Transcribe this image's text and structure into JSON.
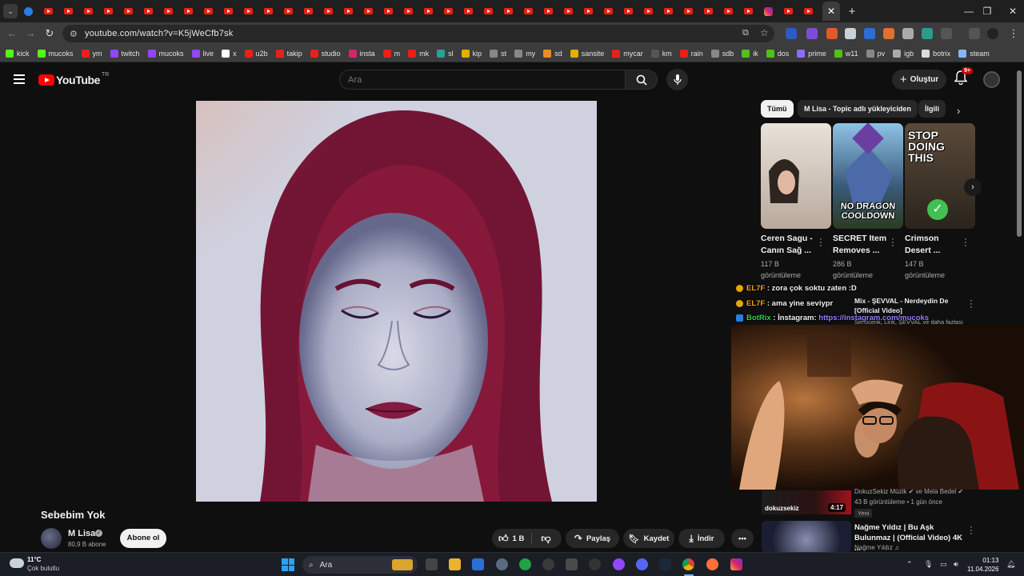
{
  "browser": {
    "url": "youtube.com/watch?v=K5jWeCfb7sk",
    "bookmarks": [
      "kick",
      "mucoks",
      "ym",
      "twitch",
      "mucoks",
      "live",
      "x",
      "u2b",
      "takip",
      "studio",
      "insta",
      "m",
      "mk",
      "sl",
      "kip",
      "st",
      "my",
      "sd",
      "sansite",
      "mycar",
      "km",
      "rain",
      "sdb",
      "ik",
      "dos",
      "prime",
      "w11",
      "pv",
      "igb",
      "botrix",
      "steam"
    ],
    "bookmark_colors": [
      "#53fc18",
      "#53fc18",
      "#e62117",
      "#9146ff",
      "#9146ff",
      "#9146ff",
      "#ffffff",
      "#e62117",
      "#e62117",
      "#e62117",
      "#d6246e",
      "#e62117",
      "#e62117",
      "#2aa198",
      "#e0b000",
      "#888888",
      "#888888",
      "#f08a24",
      "#e0b000",
      "#e62117",
      "#555555",
      "#e62117",
      "#888888",
      "#53c018",
      "#53c018",
      "#8f6bff",
      "#53c018",
      "#888888",
      "#aaaaaa",
      "#dddddd",
      "#8ab4f8"
    ]
  },
  "youtube": {
    "logo_text": "YouTube",
    "region": "TR",
    "search_placeholder": "Ara",
    "create_label": "Oluştur",
    "notif_count": "9+"
  },
  "video": {
    "title": "Sebebim Yok",
    "channel": "M Lisa",
    "subscribers": "80,9 B abone",
    "subscribe_label": "Abone ol",
    "likes": "1 B",
    "share_label": "Paylaş",
    "save_label": "Kaydet",
    "download_label": "İndir"
  },
  "sidebar": {
    "chips": [
      "Tümü",
      "M Lisa - Topic adlı yükleyiciden",
      "İlgili"
    ],
    "shorts": [
      {
        "title": "Ceren Sagu - Canın Sağ ...",
        "views": "117 B görüntüleme"
      },
      {
        "title": "SECRET Item Removes ...",
        "views": "286 B görüntüleme",
        "overlay": "NO DRAGON COOLDOWN"
      },
      {
        "title": "Crimson Desert ...",
        "views": "147 B görüntüleme",
        "overlay": "STOP DOING THIS"
      }
    ],
    "mix_title": "Mix - ŞEVVAL - Nerdeydin De [Official Video]",
    "mix_sub": "Semicenk, Lirik, ŞEVVAL ve daha fazlası",
    "rec1": {
      "channel": "DokuzSekiz Müzik ✔ ve Mela Bedel ✔",
      "meta": "43 B görüntüleme • 1 gün önce",
      "badge": "Yeni",
      "duration": "4:17",
      "thumb_text": "dokuzsekiz"
    },
    "rec2": {
      "title": "Nağme Yıldız | Bu Aşk Bulunmaz | (Official Video) 4K ...",
      "channel": "Nağme Yıldız ♫"
    }
  },
  "chat": [
    {
      "user": "EL7F",
      "msg": ": zora çok soktu zaten :D"
    },
    {
      "user": "EL7F",
      "msg": ": ama yine seviypr"
    },
    {
      "user": "BotRix",
      "msg": ": İnstagram:",
      "link": "https://instagram.com/mucoks"
    }
  ],
  "taskbar": {
    "temp": "11°C",
    "weather": "Çok bulutlu",
    "search": "Ara",
    "time": "01:13",
    "date": "11.04.2026"
  }
}
